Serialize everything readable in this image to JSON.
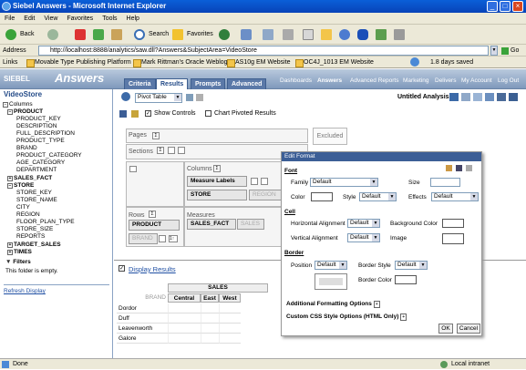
{
  "window": {
    "title": "Siebel Answers - Microsoft Internet Explorer"
  },
  "menu": [
    "File",
    "Edit",
    "View",
    "Favorites",
    "Tools",
    "Help"
  ],
  "toolbar": {
    "back": "Back",
    "search": "Search",
    "favorites": "Favorites"
  },
  "address": {
    "label": "Address",
    "url": "http://localhost:8888/analytics/saw.dll?Answers&SubjectArea=VideoStore",
    "go": "Go"
  },
  "links": {
    "label": "Links",
    "items": [
      "Movable Type Publishing Platform",
      "Mark Rittman's Oracle Weblog",
      "AS10g EM Website",
      "OC4J_1013 EM Website"
    ],
    "days": "1.8 days saved"
  },
  "siebel": {
    "logo": "SIEBEL",
    "product": "Answers",
    "tabs": [
      "Criteria",
      "Results",
      "Prompts",
      "Advanced"
    ],
    "nav": [
      "Dashboards",
      "Answers",
      "Advanced Reports",
      "Marketing",
      "Delivers",
      "My Account",
      "Log Out"
    ]
  },
  "left": {
    "subject": "VideoStore",
    "columns": "Columns",
    "product": "PRODUCT",
    "product_items": [
      "PRODUCT_KEY",
      "DESCRIPTION",
      "FULL_DESCRIPTION",
      "PRODUCT_TYPE",
      "BRAND",
      "PRODUCT_CATEGORY",
      "AGE_CATEGORY",
      "DEPARTMENT"
    ],
    "sales_fact": "SALES_FACT",
    "store": "STORE",
    "store_items": [
      "STORE_KEY",
      "STORE_NAME",
      "CITY",
      "REGION",
      "FLOOR_PLAN_TYPE",
      "STORE_SIZE",
      "REPORTS"
    ],
    "target_sales": "TARGET_SALES",
    "times": "TIMES",
    "filters": "Filters",
    "filters_empty": "This folder is empty.",
    "refresh": "Refresh Display"
  },
  "main": {
    "view": "Pivot Table",
    "analysis": "Untitled Analysis",
    "show_controls": "Show Controls",
    "chart_pivoted": "Chart Pivoted Results",
    "pages": "Pages",
    "sections": "Sections",
    "columns": "Columns",
    "rows": "Rows",
    "measures": "Measures",
    "measure_labels": "Measure Labels",
    "store": "STORE",
    "region": "REGION",
    "product": "PRODUCT",
    "brand": "BRAND",
    "sales_fact": "SALES_FACT",
    "sales": "SALES",
    "excluded": "Excluded",
    "display_results": "Display Results",
    "result": {
      "measure": "SALES",
      "rowhead": "BRAND",
      "cols": [
        "Central",
        "East",
        "West"
      ],
      "rows": [
        "Dordor",
        "Duff",
        "Leavenworth",
        "Galore"
      ]
    }
  },
  "dialog": {
    "title": "Edit Format",
    "font": "Font",
    "family": "Family",
    "family_val": "Default",
    "size": "Size",
    "color": "Color",
    "style": "Style",
    "style_val": "Default",
    "effects": "Effects",
    "effects_val": "Default",
    "cell": "Cell",
    "halign": "Horizontal Alignment",
    "halign_val": "Default",
    "bgcolor": "Background Color",
    "valign": "Vertical Alignment",
    "valign_val": "Default",
    "image": "Image",
    "border": "Border",
    "position": "Position",
    "position_val": "Default",
    "border_style": "Border Style",
    "border_style_val": "Default",
    "border_color": "Border Color",
    "additional": "Additional Formatting Options",
    "css": "Custom CSS Style Options (HTML Only)",
    "ok": "OK",
    "cancel": "Cancel"
  },
  "status": {
    "done": "Done",
    "zone": "Local intranet"
  }
}
